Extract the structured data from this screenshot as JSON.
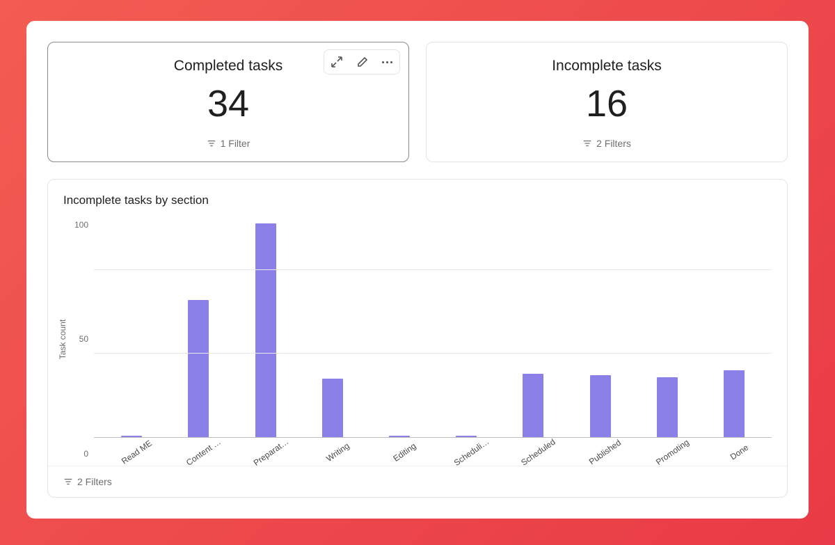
{
  "cards": {
    "completed": {
      "title": "Completed tasks",
      "value": "34",
      "filter_label": "1 Filter"
    },
    "incomplete": {
      "title": "Incomplete tasks",
      "value": "16",
      "filter_label": "2 Filters"
    }
  },
  "chart": {
    "title": "Incomplete tasks by section",
    "ylabel": "Task count",
    "filter_label": "2 Filters",
    "ticks": {
      "t0": "0",
      "t1": "50",
      "t2": "100"
    }
  },
  "chart_data": {
    "type": "bar",
    "title": "Incomplete tasks by section",
    "xlabel": "",
    "ylabel": "Task count",
    "ylim": [
      0,
      130
    ],
    "y_ticks": [
      0,
      50,
      100
    ],
    "categories": [
      "Read ME",
      "Content …",
      "Preparat…",
      "Writing",
      "Editing",
      "Scheduli…",
      "Scheduled",
      "Published",
      "Promoting",
      "Done"
    ],
    "values": [
      1,
      82,
      128,
      35,
      1,
      1,
      38,
      37,
      36,
      40
    ],
    "bar_color": "#8b80e8"
  }
}
